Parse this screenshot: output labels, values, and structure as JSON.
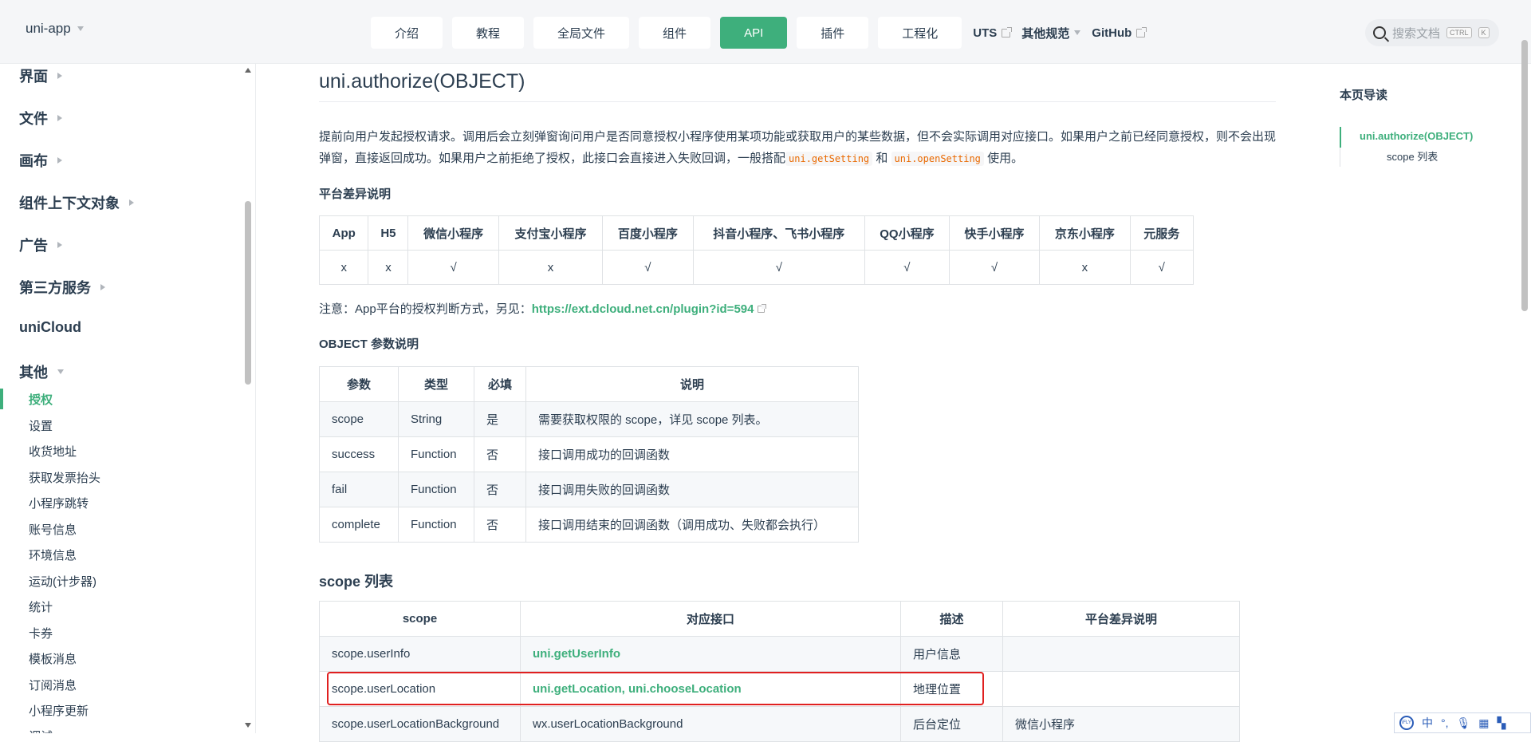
{
  "navbar": {
    "brand": "uni-app",
    "items": [
      {
        "label": "介绍",
        "active": false
      },
      {
        "label": "教程",
        "active": false
      },
      {
        "label": "全局文件",
        "active": false
      },
      {
        "label": "组件",
        "active": false
      },
      {
        "label": "API",
        "active": true
      },
      {
        "label": "插件",
        "active": false
      },
      {
        "label": "工程化",
        "active": false
      }
    ],
    "links": [
      "UTS",
      "其他规范",
      "GitHub"
    ],
    "search_placeholder": "搜索文档",
    "search_kbd_1": "CTRL",
    "search_kbd_2": "K"
  },
  "sidebar": {
    "groups": [
      "界面",
      "文件",
      "画布",
      "组件上下文对象",
      "广告",
      "第三方服务",
      "uniCloud",
      "其他"
    ],
    "items": [
      "授权",
      "设置",
      "收货地址",
      "获取发票抬头",
      "小程序跳转",
      "账号信息",
      "环境信息",
      "运动(计步器)",
      "统计",
      "卡券",
      "模板消息",
      "订阅消息",
      "小程序更新",
      "调试"
    ],
    "active_item": "授权"
  },
  "content": {
    "title": "uni.authorize(OBJECT)",
    "intro_1": "提前向用户发起授权请求。调用后会立刻弹窗询问用户是否同意授权小程序使用某项功能或获取用户的某些数据，但不会实际调用对应接口。如果用户之前已经同意授权，则不会出现弹窗，直接返回成功。如果用户之前拒绝了授权，此接口会直接进入失败回调，一般搭配",
    "intro_code_1": "uni.getSetting",
    "intro_and": "和",
    "intro_code_2": "uni.openSetting",
    "intro_end": "使用。",
    "platform_heading": "平台差异说明",
    "platform_table": {
      "headers": [
        "App",
        "H5",
        "微信小程序",
        "支付宝小程序",
        "百度小程序",
        "抖音小程序、飞书小程序",
        "QQ小程序",
        "快手小程序",
        "京东小程序",
        "元服务"
      ],
      "values": [
        "x",
        "x",
        "√",
        "x",
        "√",
        "√",
        "√",
        "√",
        "x",
        "√"
      ]
    },
    "note_prefix": "注意：App平台的授权判断方式，另见：",
    "note_link": "https://ext.dcloud.net.cn/plugin?id=594",
    "params_heading": "OBJECT 参数说明",
    "params_table": {
      "headers": [
        "参数",
        "类型",
        "必填",
        "说明"
      ],
      "rows": [
        [
          "scope",
          "String",
          "是",
          "需要获取权限的 scope，详见 scope 列表。"
        ],
        [
          "success",
          "Function",
          "否",
          "接口调用成功的回调函数"
        ],
        [
          "fail",
          "Function",
          "否",
          "接口调用失败的回调函数"
        ],
        [
          "complete",
          "Function",
          "否",
          "接口调用结束的回调函数（调用成功、失败都会执行）"
        ]
      ]
    },
    "scope_heading": "scope 列表",
    "scope_table": {
      "headers": [
        "scope",
        "对应接口",
        "描述",
        "平台差异说明"
      ],
      "rows": [
        [
          "scope.userInfo",
          "uni.getUserInfo",
          "用户信息",
          ""
        ],
        [
          "scope.userLocation",
          "uni.getLocation, uni.chooseLocation",
          "地理位置",
          ""
        ],
        [
          "scope.userLocationBackground",
          "wx.userLocationBackground",
          "后台定位",
          "微信小程序"
        ]
      ]
    }
  },
  "toc": {
    "title": "本页导读",
    "items": [
      "uni.authorize(OBJECT)",
      "scope 列表"
    ]
  },
  "ime": {
    "label": "中",
    "logo": "iFLY"
  },
  "colors": {
    "accent": "#3eaf7c",
    "highlight": "#e02020",
    "code": "#e96900"
  }
}
